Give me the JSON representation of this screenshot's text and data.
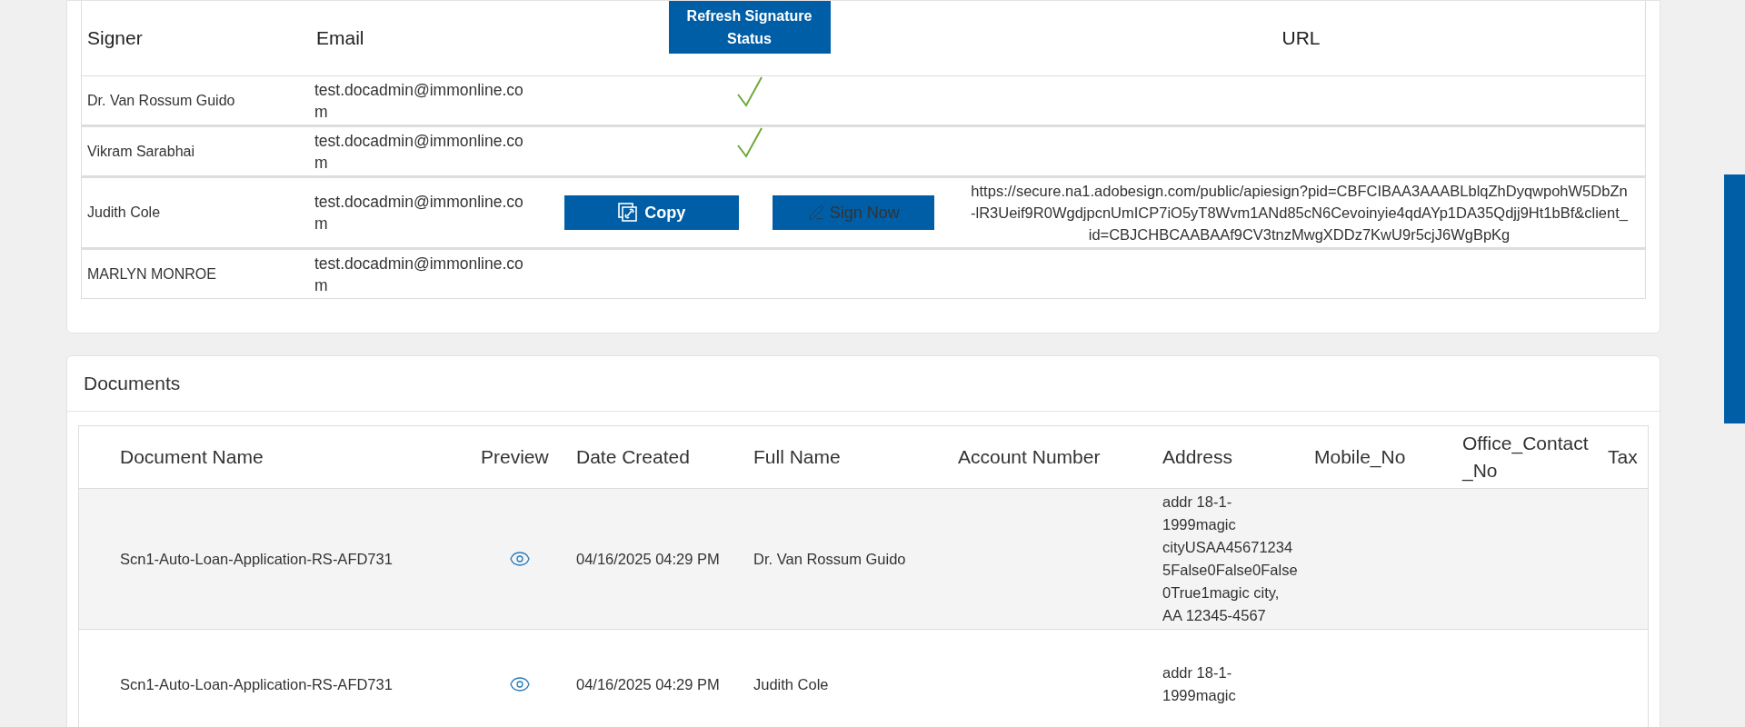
{
  "signers": {
    "columns": [
      "Signer",
      "Email",
      "URL"
    ],
    "refresh_button": "Refresh Signature Status",
    "rows": [
      {
        "signer": "Dr. Van Rossum Guido",
        "email": "test.docadmin@immonline.com",
        "kind": "signed"
      },
      {
        "signer": "Vikram Sarabhai",
        "email": "test.docadmin@immonline.com",
        "kind": "signed"
      },
      {
        "signer": "Judith Cole",
        "email": "test.docadmin@immonline.com",
        "kind": "pending",
        "copy_button": "Copy",
        "sign_button": {
          "label": "Sign Now",
          "disabled": true
        },
        "url": "https://secure.na1.adobesign.com/public/apiesign?pid=CBFCIBAA3AAABLblqZhDyqwpohW5DbZn-lR3Ueif9R0WgdjpcnUmICP7iO5yT8Wvm1ANd85cN6Cevoinyie4qdAYp1DA35Qdjj9Ht1bBf&client_id=CBJCHBCAABAAf9CV3tnzMwgXDDz7KwU9r5cjJ6WgBpKg"
      },
      {
        "signer": "MARLYN MONROE",
        "email": "test.docadmin@immonline.com",
        "kind": "none"
      }
    ]
  },
  "documents": {
    "title": "Documents",
    "columns": [
      "Document Name",
      "Preview",
      "Date Created",
      "Full Name",
      "Account Number",
      "Address",
      "Mobile_No",
      "Office_Contact_No",
      "Tax"
    ],
    "rows": [
      {
        "document_name": "Scn1-Auto-Loan-Application-RS-AFD731",
        "date_created": "04/16/2025 04:29 PM",
        "full_name": "Dr. Van Rossum Guido",
        "address": "addr 18-1-1999magic cityUSAA456712345False0False0False0True1magic city, AA 12345-4567"
      },
      {
        "document_name": "Scn1-Auto-Loan-Application-RS-AFD731",
        "date_created": "04/16/2025 04:29 PM",
        "full_name": "Judith Cole",
        "address": "addr 18-1-1999magic"
      }
    ]
  }
}
